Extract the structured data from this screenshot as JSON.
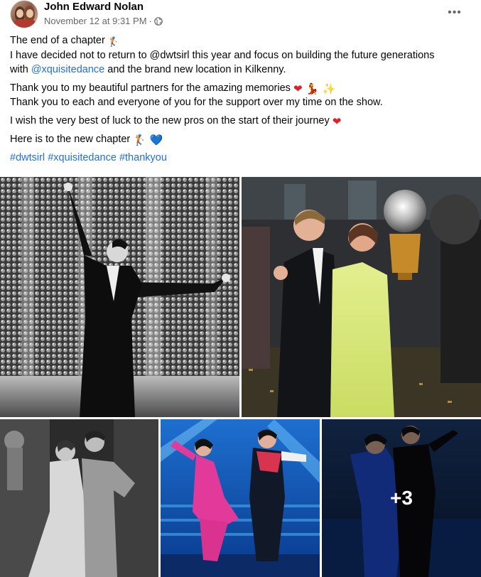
{
  "post": {
    "author": "John Edward Nolan",
    "timestamp": "November 12 at 9:31 PM",
    "separator": "·",
    "privacy_icon": "globe-icon",
    "more_icon": "more-options-icon",
    "more_label": "•••"
  },
  "text": {
    "p1_l1": "The end of a chapter",
    "p1_l1_emoji": "🏌",
    "p1_l2": "I have decided not to return to @dwtsirl this year and focus on building the future generations",
    "p1_l3_pre": "with",
    "p1_l3_link": "@xquisitedance",
    "p1_l3_post": "and the brand new location in Kilkenny.",
    "p2_l1": "Thank you to my beautiful partners for the amazing memories",
    "p2_l1_emojis": "❤ 💃 ✨",
    "p2_l2": "Thank you to each and everyone  of you for the support over my time on the show.",
    "p3": "I wish the very best of luck to the new pros on the start of their journey",
    "p3_emoji": "❤",
    "p4": "Here is to the new chapter",
    "p4_emojis": "🏌 💙",
    "hashtags": [
      "#dwtsirl",
      "#xquisitedance",
      "#thankyou"
    ]
  },
  "gallery": {
    "more_count": "+3",
    "photos": [
      "black-and-white-dance-pose-photo",
      "trophy-celebration-photo",
      "black-and-white-couple-photo",
      "pink-dress-dance-photo",
      "blue-dress-dance-photo"
    ]
  },
  "colors": {
    "link": "#216fdb",
    "meta": "#65676b",
    "heart": "#e0212b"
  }
}
